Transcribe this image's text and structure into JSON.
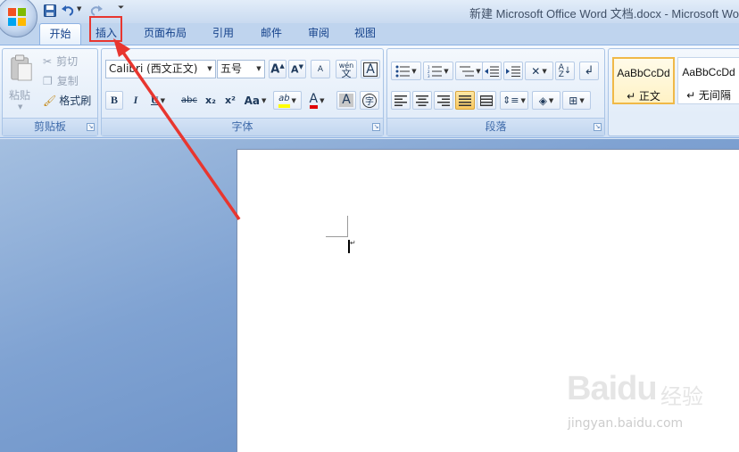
{
  "window": {
    "title": "新建 Microsoft Office Word 文档.docx - Microsoft Wo"
  },
  "quick_access": {
    "icons": [
      "save-icon",
      "undo-icon",
      "redo-icon",
      "customize-icon"
    ]
  },
  "tabs": [
    {
      "label": "开始",
      "active": true
    },
    {
      "label": "插入",
      "active": false,
      "highlighted": true
    },
    {
      "label": "页面布局",
      "active": false
    },
    {
      "label": "引用",
      "active": false
    },
    {
      "label": "邮件",
      "active": false
    },
    {
      "label": "审阅",
      "active": false
    },
    {
      "label": "视图",
      "active": false
    }
  ],
  "ribbon": {
    "clipboard": {
      "label": "剪贴板",
      "paste": "粘贴",
      "cut": "剪切",
      "copy": "复制",
      "format_painter": "格式刷"
    },
    "font": {
      "label": "字体",
      "font_name": "Calibri (西文正文)",
      "font_size": "五号",
      "bold": "B",
      "italic": "I",
      "underline": "U",
      "strike": "abc",
      "subscript": "x₂",
      "superscript": "x²",
      "change_case": "Aa",
      "highlight": "ab",
      "font_color": "A",
      "char_shading": "A",
      "enclose": "字",
      "phonetic": "wén",
      "phonetic_sub": "文",
      "clear": "A"
    },
    "paragraph": {
      "label": "段落"
    },
    "styles": {
      "items": [
        {
          "sample": "AaBbCcDd",
          "name": "↵ 正文",
          "selected": true
        },
        {
          "sample": "AaBbCcDd",
          "name": "↵ 无间隔",
          "selected": false
        }
      ]
    }
  },
  "watermark": {
    "logo": "Baidu",
    "jingyan": "经验",
    "url": "jingyan.baidu.com"
  },
  "colors": {
    "annotation_red": "#e8362f",
    "highlight_yellow": "#ffff00",
    "font_color_red": "#e00000"
  }
}
